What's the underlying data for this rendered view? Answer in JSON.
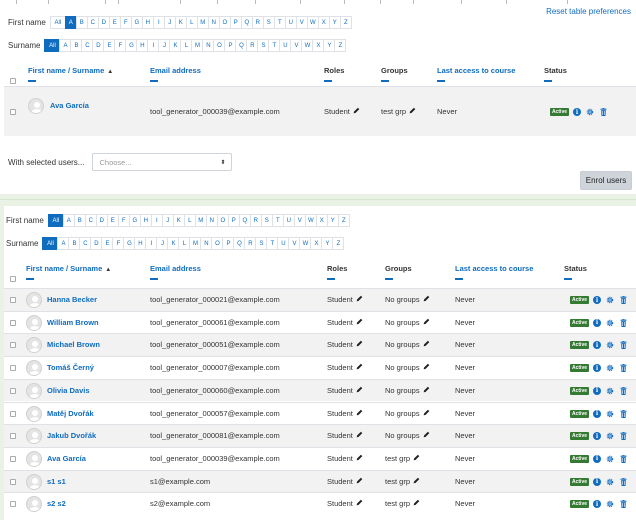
{
  "reset_link": "Reset table preferences",
  "filters": {
    "firstname_label": "First name",
    "surname_label": "Surname",
    "all_label": "All",
    "letters": [
      "A",
      "B",
      "C",
      "D",
      "E",
      "F",
      "G",
      "H",
      "I",
      "J",
      "K",
      "L",
      "M",
      "N",
      "O",
      "P",
      "Q",
      "R",
      "S",
      "T",
      "U",
      "V",
      "W",
      "X",
      "Y",
      "Z"
    ]
  },
  "table1": {
    "active_firstname": "A",
    "active_surname": "All",
    "headers": {
      "name": "First name / Surname",
      "email": "Email address",
      "roles": "Roles",
      "groups": "Groups",
      "last_access": "Last access to course",
      "status": "Status"
    },
    "rows": [
      {
        "name": "Ava García",
        "email": "tool_generator_000039@example.com",
        "role": "Student",
        "groups": "test grp",
        "last_access": "Never",
        "status": "Active"
      }
    ]
  },
  "bulk": {
    "label": "With selected users...",
    "placeholder": "Choose..."
  },
  "enrol_button": "Enrol users",
  "table2": {
    "active_firstname": "All",
    "active_surname": "All",
    "headers": {
      "name": "First name / Surname",
      "email": "Email address",
      "roles": "Roles",
      "groups": "Groups",
      "last_access": "Last access to course",
      "status": "Status"
    },
    "rows": [
      {
        "name": "Hanna Becker",
        "email": "tool_generator_000021@example.com",
        "role": "Student",
        "groups": "No groups",
        "last_access": "Never",
        "status": "Active"
      },
      {
        "name": "William Brown",
        "email": "tool_generator_000061@example.com",
        "role": "Student",
        "groups": "No groups",
        "last_access": "Never",
        "status": "Active"
      },
      {
        "name": "Michael Brown",
        "email": "tool_generator_000051@example.com",
        "role": "Student",
        "groups": "No groups",
        "last_access": "Never",
        "status": "Active"
      },
      {
        "name": "Tomáš Černý",
        "email": "tool_generator_000007@example.com",
        "role": "Student",
        "groups": "No groups",
        "last_access": "Never",
        "status": "Active"
      },
      {
        "name": "Olivia Davis",
        "email": "tool_generator_000060@example.com",
        "role": "Student",
        "groups": "No groups",
        "last_access": "Never",
        "status": "Active"
      },
      {
        "name": "Matěj Dvořák",
        "email": "tool_generator_000057@example.com",
        "role": "Student",
        "groups": "No groups",
        "last_access": "Never",
        "status": "Active"
      },
      {
        "name": "Jakub Dvořák",
        "email": "tool_generator_000081@example.com",
        "role": "Student",
        "groups": "No groups",
        "last_access": "Never",
        "status": "Active"
      },
      {
        "name": "Ava García",
        "email": "tool_generator_000039@example.com",
        "role": "Student",
        "groups": "test grp",
        "last_access": "Never",
        "status": "Active"
      },
      {
        "name": "s1 s1",
        "email": "s1@example.com",
        "role": "Student",
        "groups": "test grp",
        "last_access": "Never",
        "status": "Active"
      },
      {
        "name": "s2 s2",
        "email": "s2@example.com",
        "role": "Student",
        "groups": "test grp",
        "last_access": "Never",
        "status": "Active"
      }
    ]
  },
  "colors": {
    "link": "#0f6cbf",
    "active_badge": "#357a32",
    "row_alt": "#f2f2f2",
    "region_bg": "#e9f2e4"
  },
  "icons": {
    "edit": "pencil-icon",
    "info": "info-icon",
    "settings": "gear-icon",
    "delete": "trash-icon",
    "sort": "sort-asc-icon",
    "select": "chevron-updown-icon"
  }
}
